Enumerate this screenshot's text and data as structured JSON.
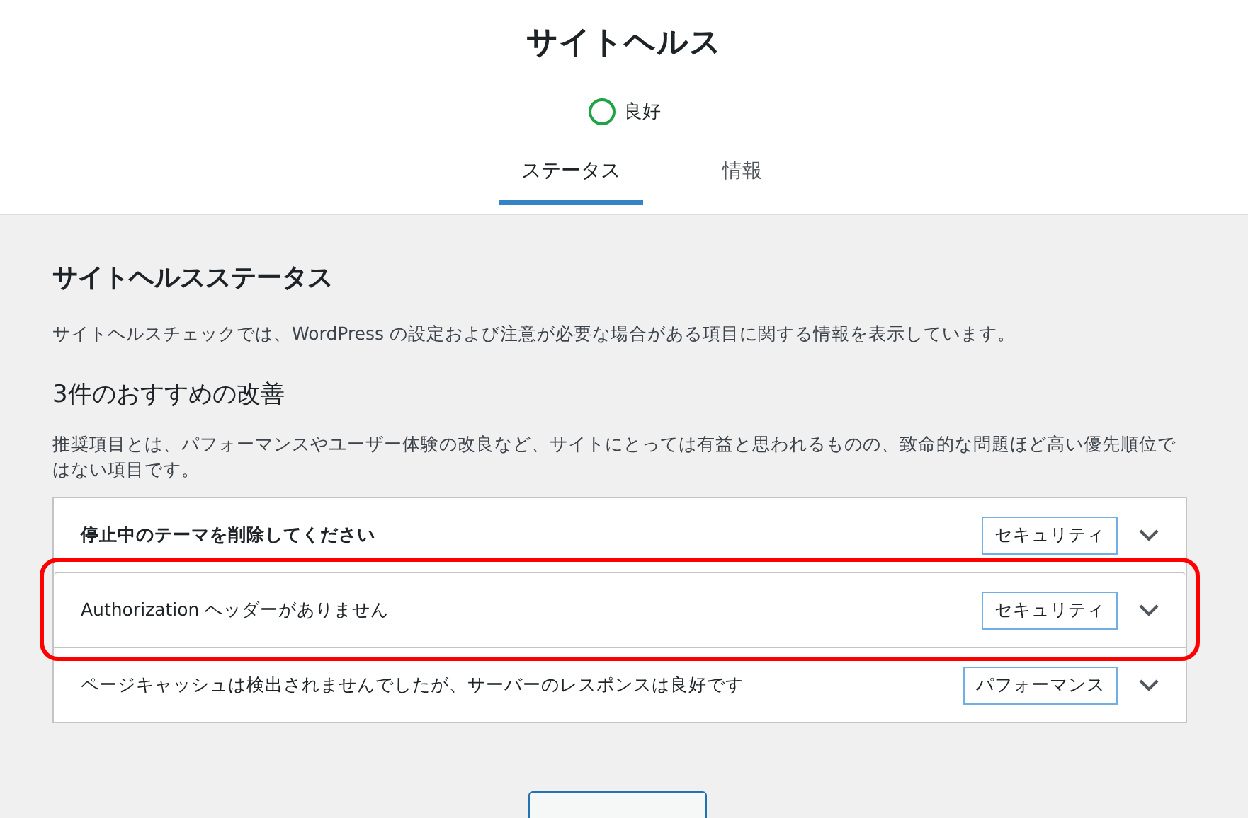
{
  "header": {
    "title": "サイトヘルス",
    "status": {
      "label": "良好"
    },
    "tabs": [
      {
        "label": "ステータス",
        "selected": true
      },
      {
        "label": "情報",
        "selected": false
      }
    ]
  },
  "content": {
    "title": "サイトヘルスステータス",
    "description": "サイトヘルスチェックでは、WordPress の設定および注意が必要な場合がある項目に関する情報を表示しています。",
    "section_title": "3件のおすすめの改善",
    "section_description": "推奨項目とは、パフォーマンスやユーザー体験の改良など、サイトにとっては有益と思われるものの、致命的な問題ほど高い優先順位ではない項目です。",
    "items": [
      {
        "label": "停止中のテーマを削除してください",
        "tag": "セキュリティ",
        "expanded": false,
        "highlighted": false,
        "bold": true
      },
      {
        "label": "Authorization ヘッダーがありません",
        "tag": "セキュリティ",
        "expanded": false,
        "highlighted": true,
        "bold": false
      },
      {
        "label": "ページキャッシュは検出されませんでしたが、サーバーのレスポンスは良好です",
        "tag": "パフォーマンス",
        "expanded": false,
        "highlighted": false,
        "bold": false
      }
    ]
  }
}
